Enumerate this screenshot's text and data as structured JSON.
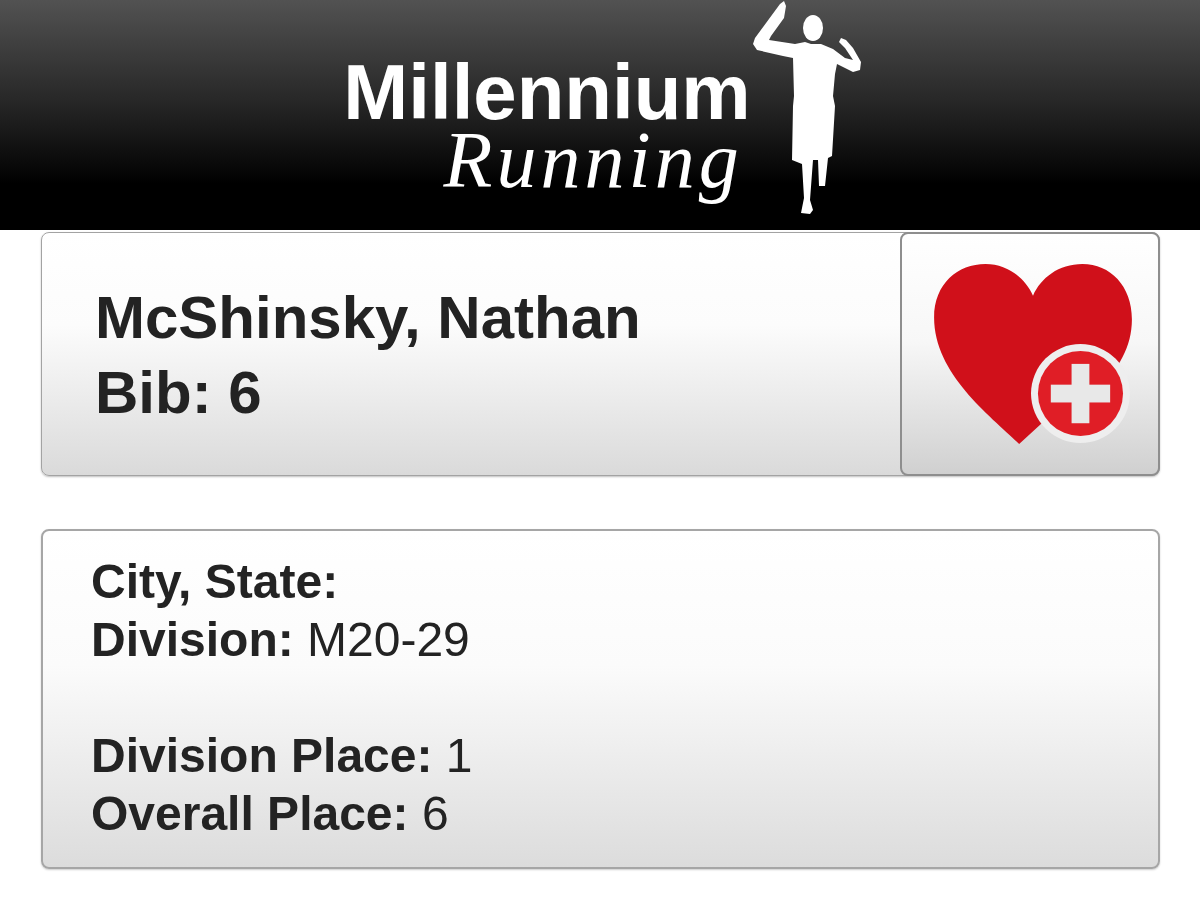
{
  "header": {
    "logo": {
      "line_1": "Millennium",
      "line_2": "Running"
    }
  },
  "runner": {
    "name": "McShinsky, Nathan",
    "bib": "Bib: 6"
  },
  "details": {
    "sections": [
      {
        "rows": [
          {
            "label": "City, State:"
          },
          {
            "label": "Division:",
            "value": "M20-29"
          }
        ]
      },
      {
        "rows": [
          {
            "label": "Division Place:",
            "value": "1"
          },
          {
            "label": "Overall Place:",
            "value": "6"
          }
        ]
      }
    ]
  }
}
